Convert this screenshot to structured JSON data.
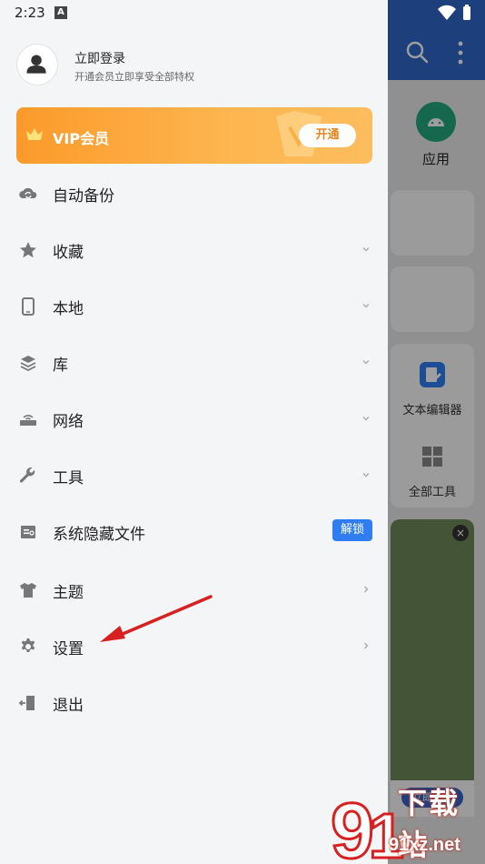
{
  "status_bar": {
    "time": "2:23",
    "notification_letter": "A"
  },
  "user": {
    "name": "立即登录",
    "subtitle": "开通会员立即享受全部特权"
  },
  "vip": {
    "label": "VIP会员",
    "button": "开通"
  },
  "menu": [
    {
      "label": "自动备份",
      "icon": "cloud-sync-icon",
      "trailing": "none"
    },
    {
      "label": "收藏",
      "icon": "star-icon",
      "trailing": "chevron-down"
    },
    {
      "label": "本地",
      "icon": "phone-icon",
      "trailing": "chevron-down"
    },
    {
      "label": "库",
      "icon": "layers-icon",
      "trailing": "chevron-down"
    },
    {
      "label": "网络",
      "icon": "router-icon",
      "trailing": "chevron-down"
    },
    {
      "label": "工具",
      "icon": "wrench-icon",
      "trailing": "chevron-down"
    },
    {
      "label": "系统隐藏文件",
      "icon": "hidden-file-icon",
      "trailing": "badge",
      "badge": "解锁"
    },
    {
      "label": "主题",
      "icon": "tshirt-icon",
      "trailing": "chevron-right"
    },
    {
      "label": "设置",
      "icon": "gear-icon",
      "trailing": "chevron-right"
    },
    {
      "label": "退出",
      "icon": "exit-icon",
      "trailing": "none"
    }
  ],
  "background_app": {
    "app_tile_label": "应用",
    "tool_text_editor": "文本编辑器",
    "tool_all": "全部工具",
    "ad_button": "立即下载",
    "ad_close": "×"
  },
  "watermark": {
    "brand": "下载站",
    "domain": "91xz.net"
  },
  "colors": {
    "drawer_bg": "#f4f5f7",
    "appbar": "#2f66c9",
    "vip_orange": "#fb9a2b",
    "unlock_blue": "#2f7df0",
    "arrow_red": "#d7201f"
  }
}
